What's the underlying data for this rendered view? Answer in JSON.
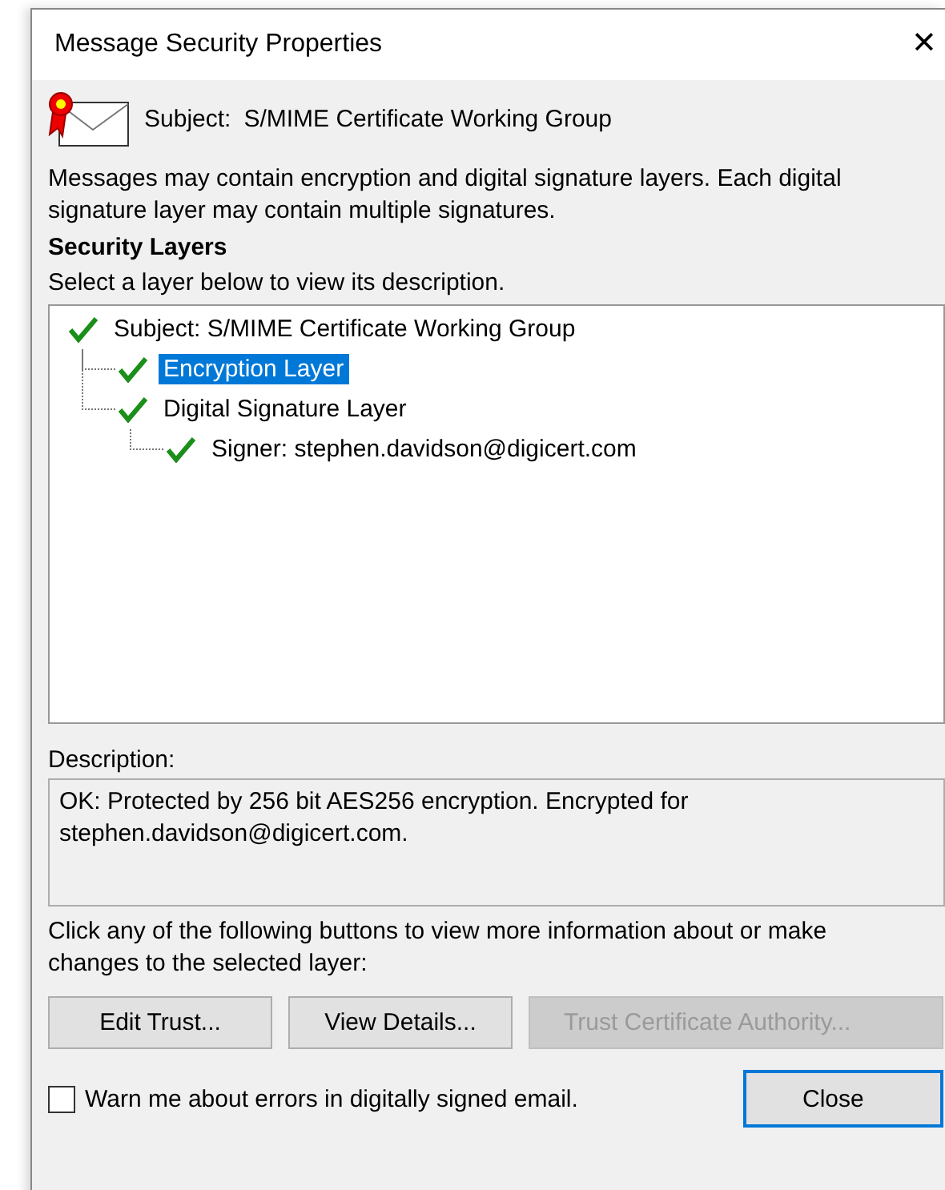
{
  "window": {
    "title": "Message Security Properties",
    "close": "✕"
  },
  "subject": {
    "label": "Subject:",
    "value": "S/MIME Certificate Working Group"
  },
  "intro": "Messages may contain encryption and digital signature layers. Each digital signature layer may contain multiple signatures.",
  "layers_heading": "Security Layers",
  "layers_hint": "Select a layer below to view its description.",
  "tree": [
    {
      "label": "Subject: S/MIME Certificate Working Group",
      "valid": true,
      "selected": false,
      "children": [
        {
          "label": "Encryption Layer",
          "valid": true,
          "selected": true
        },
        {
          "label": "Digital Signature Layer",
          "valid": true,
          "selected": false,
          "children": [
            {
              "label": "Signer: stephen.davidson@digicert.com",
              "valid": true,
              "selected": false
            }
          ]
        }
      ]
    }
  ],
  "description": {
    "label": "Description:",
    "text": "OK: Protected by 256 bit AES256 encryption. Encrypted for stephen.davidson@digicert.com."
  },
  "actions_hint": "Click any of the following buttons to view more information about or make changes to the selected layer:",
  "buttons": [
    {
      "label": "Edit Trust...",
      "disabled": false
    },
    {
      "label": "View Details...",
      "disabled": false
    },
    {
      "label": "Trust Certificate Authority...",
      "disabled": true
    }
  ],
  "warn_checkbox": {
    "label": "Warn me about errors in digitally signed email.",
    "checked": false
  },
  "close_button": {
    "label": "Close",
    "default": true
  }
}
